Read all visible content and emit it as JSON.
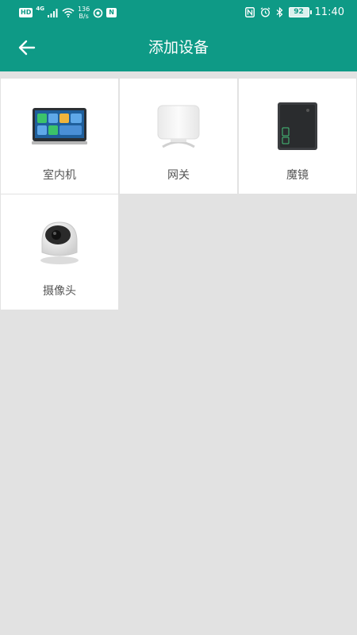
{
  "status_bar": {
    "hd": "HD",
    "network": "4G",
    "speed_value": "136",
    "speed_unit": "B/s",
    "n_badge": "N",
    "battery": "92",
    "time": "11:40"
  },
  "header": {
    "title": "添加设备"
  },
  "devices": [
    {
      "label": "室内机"
    },
    {
      "label": "网关"
    },
    {
      "label": "魔镜"
    },
    {
      "label": "摄像头"
    }
  ],
  "colors": {
    "primary": "#0e9a86",
    "background": "#e2e2e2",
    "card": "#ffffff",
    "label": "#555555"
  }
}
